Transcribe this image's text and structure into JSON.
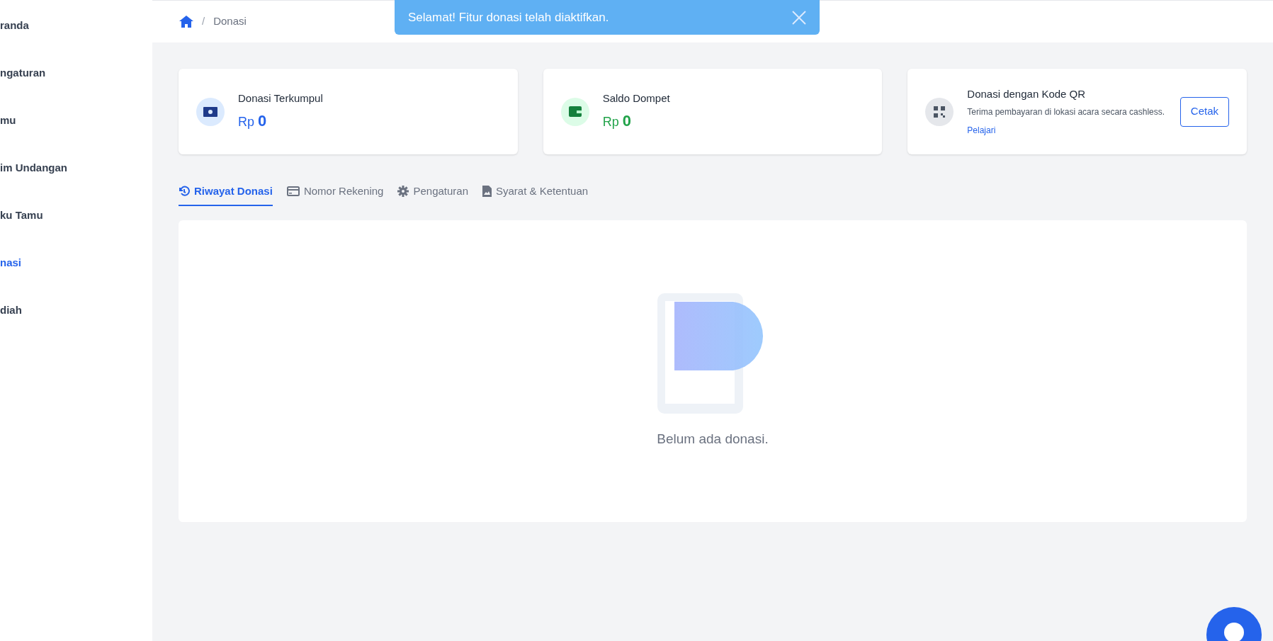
{
  "sidebar": {
    "items": [
      {
        "label": "randa",
        "selected": false
      },
      {
        "label": "ngaturan",
        "selected": false
      },
      {
        "label": "mu",
        "selected": false
      },
      {
        "label": "im Undangan",
        "selected": false
      },
      {
        "label": "ku Tamu",
        "selected": false
      },
      {
        "label": "nasi",
        "selected": true
      },
      {
        "label": "diah",
        "selected": false
      }
    ]
  },
  "breadcrumb": {
    "separator": "/",
    "current": "Donasi"
  },
  "toast": {
    "message": "Selamat! Fitur donasi telah diaktifkan."
  },
  "cards": [
    {
      "kind": "stat",
      "title": "Donasi Terkumpul",
      "currency": "Rp",
      "value": "0",
      "color": "#2563eb"
    },
    {
      "kind": "stat",
      "title": "Saldo Dompet",
      "currency": "Rp",
      "value": "0",
      "color": "#22a34a"
    },
    {
      "kind": "qr",
      "title": "Donasi dengan Kode QR",
      "description": "Terima pembayaran di lokasi acara secara cashless.",
      "link": "Pelajari",
      "button": "Cetak"
    }
  ],
  "tabs": [
    {
      "label": "Riwayat Donasi",
      "selected": true
    },
    {
      "label": "Nomor Rekening",
      "selected": false
    },
    {
      "label": "Pengaturan",
      "selected": false
    },
    {
      "label": "Syarat & Ketentuan",
      "selected": false
    }
  ],
  "empty_state": {
    "message": "Belum ada donasi."
  }
}
